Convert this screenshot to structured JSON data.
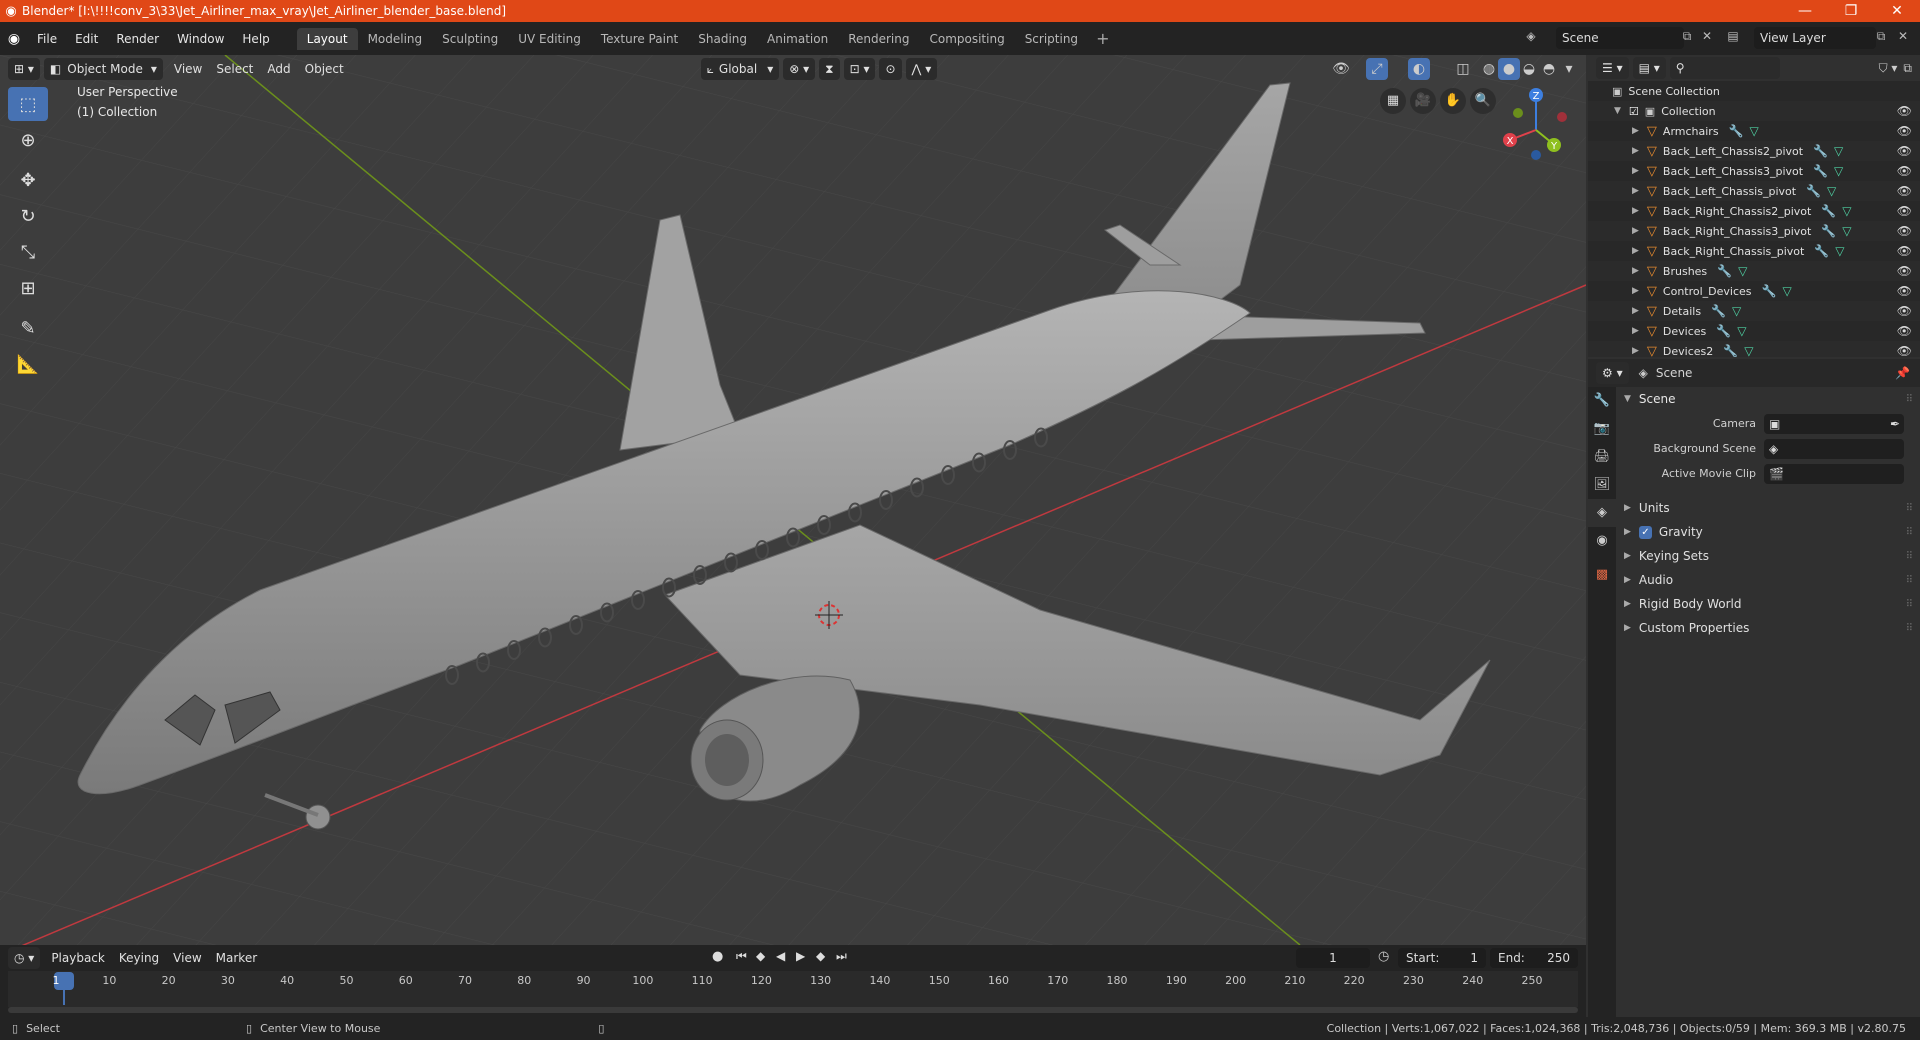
{
  "window": {
    "title": "Blender* [I:\\!!!!conv_3\\33\\Jet_Airliner_max_vray\\Jet_Airliner_blender_base.blend]",
    "minimize": "—",
    "maximize": "❐",
    "close": "✕"
  },
  "menu": [
    "File",
    "Edit",
    "Render",
    "Window",
    "Help"
  ],
  "workspaces": [
    "Layout",
    "Modeling",
    "Sculpting",
    "UV Editing",
    "Texture Paint",
    "Shading",
    "Animation",
    "Rendering",
    "Compositing",
    "Scripting"
  ],
  "active_workspace": "Layout",
  "scene_name": "Scene",
  "view_layer": "View Layer",
  "viewport": {
    "mode": "Object Mode",
    "menus": [
      "View",
      "Select",
      "Add",
      "Object"
    ],
    "orientation": "Global",
    "perspective_label": "User Perspective",
    "collection_label": "(1) Collection",
    "gizmo": {
      "x": "X",
      "y": "Y",
      "z": "Z"
    }
  },
  "timeline": {
    "menus": [
      "Playback",
      "Keying",
      "View",
      "Marker"
    ],
    "current_frame": "1",
    "start_label": "Start:",
    "start": "1",
    "end_label": "End:",
    "end": "250",
    "ticks": [
      "1",
      "10",
      "20",
      "30",
      "40",
      "50",
      "60",
      "70",
      "80",
      "90",
      "100",
      "110",
      "120",
      "130",
      "140",
      "150",
      "160",
      "170",
      "180",
      "190",
      "200",
      "210",
      "220",
      "230",
      "240",
      "250"
    ]
  },
  "statusbar": {
    "left": "Select",
    "middle": "Center View to Mouse",
    "right": "Collection | Verts:1,067,022 | Faces:1,024,368 | Tris:2,048,736 | Objects:0/59 | Mem: 369.3 MB | v2.80.75"
  },
  "outliner": {
    "root": "Scene Collection",
    "collection": "Collection",
    "items": [
      "Armchairs",
      "Back_Left_Chassis2_pivot",
      "Back_Left_Chassis3_pivot",
      "Back_Left_Chassis_pivot",
      "Back_Right_Chassis2_pivot",
      "Back_Right_Chassis3_pivot",
      "Back_Right_Chassis_pivot",
      "Brushes",
      "Control_Devices",
      "Details",
      "Devices",
      "Devices2"
    ]
  },
  "properties": {
    "context": "Scene",
    "panel": "Scene",
    "camera_label": "Camera",
    "background_label": "Background Scene",
    "movieclip_label": "Active Movie Clip",
    "subpanels": [
      "Units",
      "Gravity",
      "Keying Sets",
      "Audio",
      "Rigid Body World",
      "Custom Properties"
    ]
  },
  "colors": {
    "accent": "#4772b3",
    "titlebar": "#e04817",
    "x_axis": "#e0414b",
    "y_axis": "#8fc01f",
    "z_axis": "#3d7fe0"
  }
}
